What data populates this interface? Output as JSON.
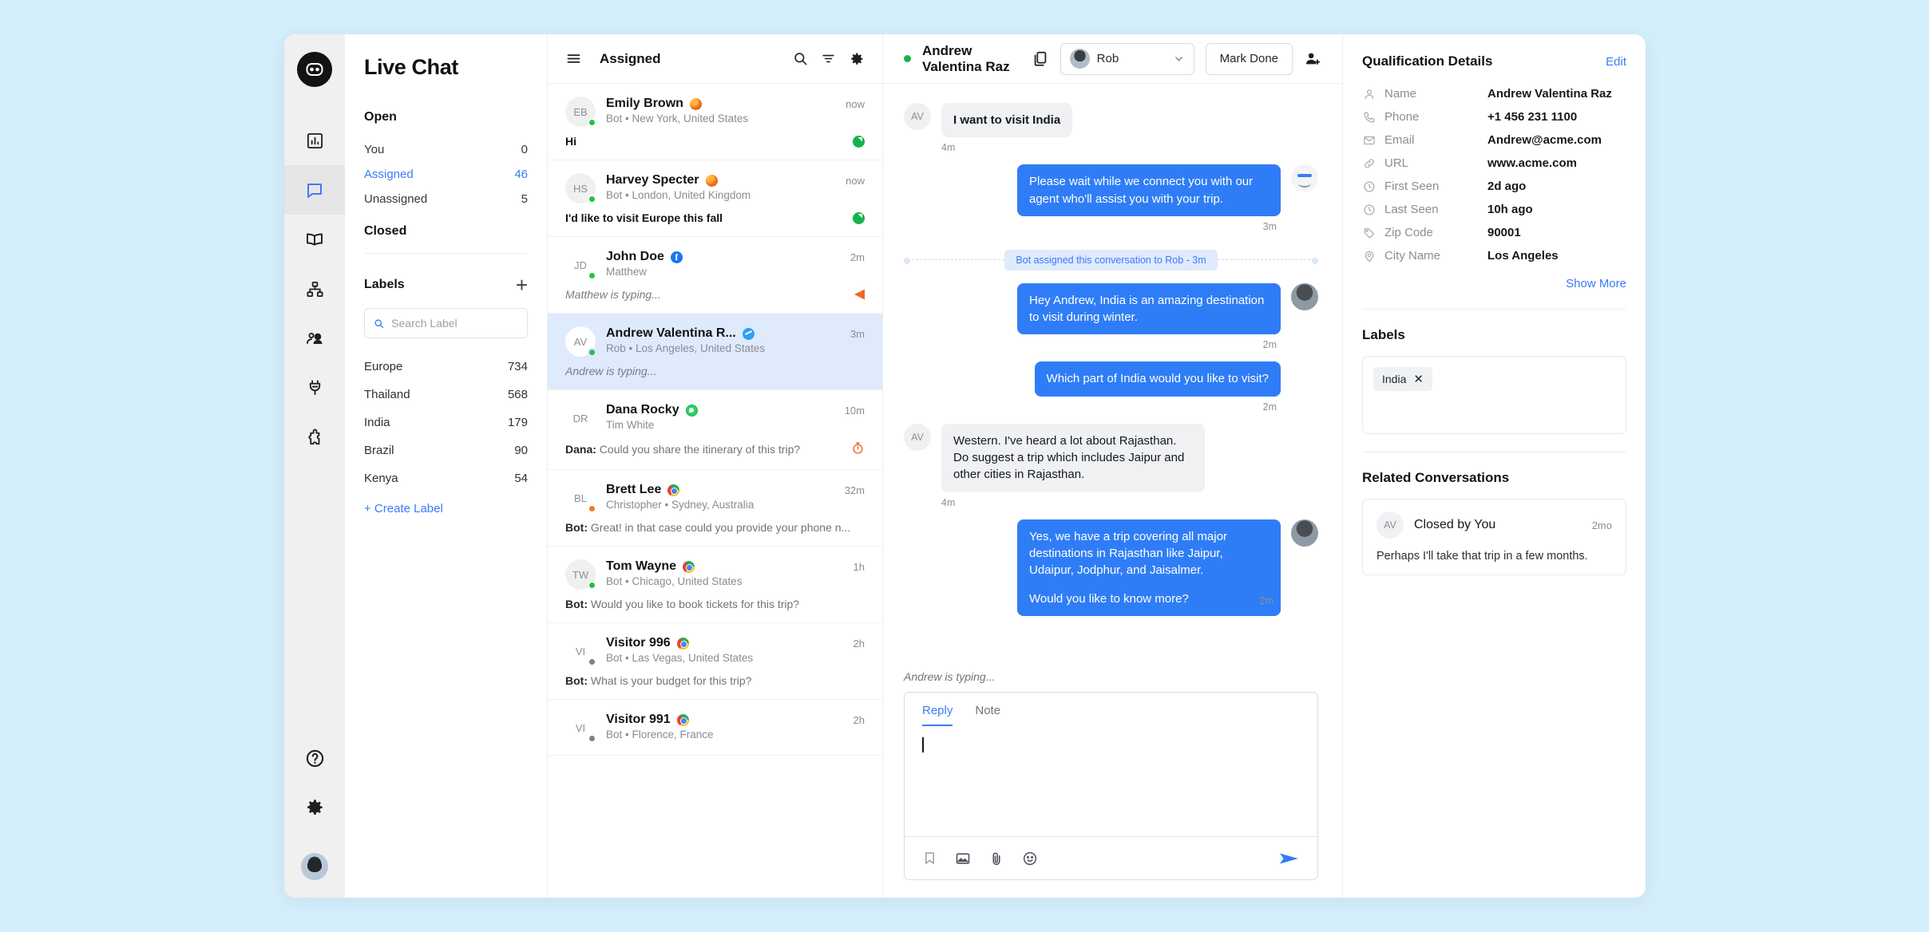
{
  "brand": "Live Chat",
  "rail": {
    "logo_icon": "chatbot-logo-icon",
    "items": [
      {
        "icon": "reports-bar-chart-icon",
        "active": false
      },
      {
        "icon": "conversations-chat-icon",
        "active": true
      },
      {
        "icon": "knowledge-book-icon",
        "active": false
      },
      {
        "icon": "bot-flow-sitemap-icon",
        "active": false
      },
      {
        "icon": "contacts-people-icon",
        "active": false
      },
      {
        "icon": "integrations-plug-icon",
        "active": false
      },
      {
        "icon": "apps-puzzle-icon",
        "active": false
      }
    ],
    "bottom": [
      {
        "icon": "help-question-icon"
      },
      {
        "icon": "settings-gear-icon"
      }
    ],
    "avatar_icon": "user-avatar"
  },
  "sidebar": {
    "open_title": "Open",
    "open_items": [
      {
        "label": "You",
        "count": "0",
        "active": false
      },
      {
        "label": "Assigned",
        "count": "46",
        "active": true
      },
      {
        "label": "Unassigned",
        "count": "5",
        "active": false
      }
    ],
    "closed_title": "Closed",
    "labels_title": "Labels",
    "add_label_icon": "plus-icon",
    "search_placeholder": "Search Label",
    "search_value": "",
    "labels": [
      {
        "label": "Europe",
        "count": "734"
      },
      {
        "label": "Thailand",
        "count": "568"
      },
      {
        "label": "India",
        "count": "179"
      },
      {
        "label": "Brazil",
        "count": "90"
      },
      {
        "label": "Kenya",
        "count": "54"
      }
    ],
    "create_label": "+ Create Label"
  },
  "conv_header": {
    "menu_icon": "hamburger-menu-icon",
    "title": "Assigned",
    "search_icon": "search-icon",
    "filter_icon": "filter-icon",
    "settings_icon": "gear-icon"
  },
  "conversations": [
    {
      "initials": "EB",
      "name": "Emily Brown",
      "channel": "firefox",
      "sub": "Bot • New York, United States",
      "time": "now",
      "preview": "Hi",
      "preview_prefix": "",
      "status": "online",
      "badge": "green-check",
      "bold": true,
      "typing": false,
      "selected": false
    },
    {
      "initials": "HS",
      "name": "Harvey Specter",
      "channel": "firefox",
      "sub": "Bot • London, United Kingdom",
      "time": "now",
      "preview": "I'd like to visit Europe this fall",
      "preview_prefix": "",
      "status": "online",
      "badge": "green-check",
      "bold": true,
      "typing": false,
      "selected": false
    },
    {
      "initials": "JD",
      "name": "John Doe",
      "channel": "facebook",
      "sub": "Matthew",
      "time": "2m",
      "preview": "Matthew is typing...",
      "preview_prefix": "",
      "status": "online",
      "badge": "orange-arrow",
      "bold": false,
      "typing": true,
      "selected": false
    },
    {
      "initials": "AV",
      "name": "Andrew Valentina R...",
      "channel": "telegram",
      "sub": "Rob • Los Angeles, United States",
      "time": "3m",
      "preview": "Andrew is typing...",
      "preview_prefix": "",
      "status": "online",
      "badge": "",
      "bold": false,
      "typing": true,
      "selected": true
    },
    {
      "initials": "DR",
      "name": "Dana Rocky",
      "channel": "whatsapp",
      "sub": "Tim White",
      "time": "10m",
      "preview": "Could you share the itinerary of this trip?",
      "preview_prefix": "Dana:",
      "status": "",
      "badge": "snooze-timer",
      "bold": false,
      "typing": false,
      "selected": false
    },
    {
      "initials": "BL",
      "name": "Brett Lee",
      "channel": "chrome",
      "sub": "Christopher • Sydney, Australia",
      "time": "32m",
      "preview": "Great! in that case could you provide your phone n...",
      "preview_prefix": "Bot:",
      "status": "away",
      "badge": "",
      "bold": false,
      "typing": false,
      "selected": false
    },
    {
      "initials": "TW",
      "name": "Tom Wayne",
      "channel": "chrome",
      "sub": "Bot • Chicago, United States",
      "time": "1h",
      "preview": "Would you like to book tickets for this trip?",
      "preview_prefix": "Bot:",
      "status": "online",
      "badge": "",
      "bold": false,
      "typing": false,
      "selected": false
    },
    {
      "initials": "VI",
      "name": "Visitor 996",
      "channel": "chrome",
      "sub": "Bot • Las Vegas, United States",
      "time": "2h",
      "preview": "What is your budget for this trip?",
      "preview_prefix": "Bot:",
      "status": "offline",
      "badge": "",
      "bold": false,
      "typing": false,
      "selected": false
    },
    {
      "initials": "VI",
      "name": "Visitor 991",
      "channel": "chrome",
      "sub": "Bot • Florence, France",
      "time": "2h",
      "preview": "",
      "preview_prefix": "",
      "status": "offline",
      "badge": "",
      "bold": false,
      "typing": false,
      "selected": false
    }
  ],
  "chat_header": {
    "title": "Andrew Valentina Raz",
    "presence": "online",
    "copy_icon": "copy-transcript-icon",
    "assignee_name": "Rob",
    "assignee_chevron": "chevron-down-icon",
    "mark_done_label": "Mark Done",
    "add_participant_icon": "add-person-icon"
  },
  "messages": [
    {
      "kind": "in",
      "avatar": "AV",
      "text": "I want to visit India",
      "time": "4m",
      "style": "bold"
    },
    {
      "kind": "out",
      "avatar": "bot",
      "text": "Please wait while we connect you with our agent who'll assist you with your trip.",
      "time": "3m"
    },
    {
      "kind": "system",
      "text": "Bot assigned this conversation to Rob - 3m"
    },
    {
      "kind": "out",
      "avatar": "agent",
      "text": "Hey Andrew, India is an amazing destination to visit during winter.",
      "time": "2m"
    },
    {
      "kind": "out",
      "avatar": "",
      "text": "Which part of India would you like to visit?",
      "time": "2m"
    },
    {
      "kind": "in",
      "avatar": "AV",
      "text": "Western. I've heard a lot about Rajasthan. Do suggest a trip which includes Jaipur and other cities in Rajasthan.",
      "time": "4m",
      "style": "plain"
    },
    {
      "kind": "out",
      "avatar": "agent",
      "text": "Yes, we have a trip covering all major destinations in Rajasthan like Jaipur, Udaipur, Jodphur, and Jaisalmer.",
      "text2": "Would you like to know more?",
      "time": "2m"
    }
  ],
  "composer": {
    "typing_note": "Andrew is typing...",
    "tabs": [
      {
        "label": "Reply",
        "active": true
      },
      {
        "label": "Note",
        "active": false
      }
    ],
    "value": "",
    "tools": [
      {
        "icon": "canned-response-bookmark-icon"
      },
      {
        "icon": "image-icon"
      },
      {
        "icon": "attachment-paperclip-icon"
      },
      {
        "icon": "emoji-smiley-icon"
      }
    ],
    "send_icon": "send-paper-plane-icon"
  },
  "details": {
    "title": "Qualification Details",
    "edit_label": "Edit",
    "rows": [
      {
        "icon": "person-icon",
        "label": "Name",
        "value": "Andrew Valentina Raz"
      },
      {
        "icon": "phone-icon",
        "label": "Phone",
        "value": "+1 456 231 1100"
      },
      {
        "icon": "envelope-icon",
        "label": "Email",
        "value": "Andrew@acme.com"
      },
      {
        "icon": "link-icon",
        "label": "URL",
        "value": "www.acme.com"
      },
      {
        "icon": "clock-icon",
        "label": "First Seen",
        "value": "2d ago"
      },
      {
        "icon": "clock-icon",
        "label": "Last Seen",
        "value": "10h ago"
      },
      {
        "icon": "tag-icon",
        "label": "Zip Code",
        "value": "90001"
      },
      {
        "icon": "location-pin-icon",
        "label": "City Name",
        "value": "Los Angeles"
      }
    ],
    "show_more": "Show More",
    "labels_title": "Labels",
    "label_chips": [
      {
        "text": "India",
        "remove_icon": "close-x-icon"
      }
    ],
    "related_title": "Related Conversations",
    "related": [
      {
        "initials": "AV",
        "name": "Closed by You",
        "time": "2mo",
        "message": "Perhaps I'll take that trip in a few months."
      }
    ]
  }
}
